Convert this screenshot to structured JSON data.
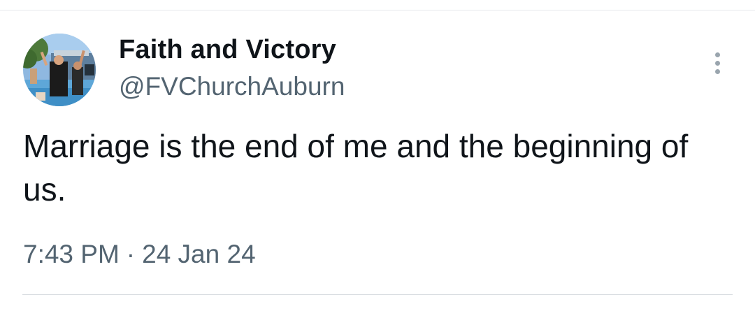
{
  "tweet": {
    "author": {
      "display_name": "Faith and Victory",
      "handle": "@FVChurchAuburn",
      "avatar_icon": "profile-photo"
    },
    "more_icon": "more-options-icon",
    "text": "Marriage is the end of me and the beginning of us.",
    "time": "7:43 PM",
    "separator": "·",
    "date": "24 Jan 24"
  },
  "colors": {
    "text_primary": "#0f1419",
    "text_secondary": "#536471",
    "divider": "#e6e9ec"
  }
}
